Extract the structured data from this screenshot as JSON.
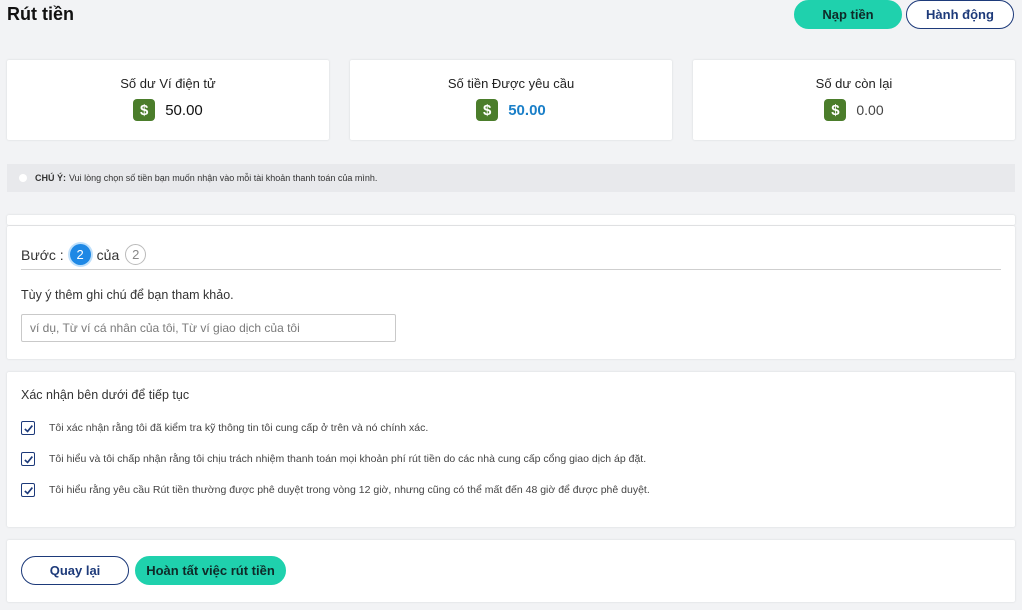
{
  "page": {
    "title": "Rút tiền"
  },
  "header": {
    "deposit_label": "Nạp tiền",
    "actions_label": "Hành động"
  },
  "stats": [
    {
      "title": "Số dư Ví điện tử",
      "value": "50.00"
    },
    {
      "title": "Số tiền Được yêu cầu",
      "value": "50.00"
    },
    {
      "title": "Số dư còn lại",
      "value": "0.00"
    }
  ],
  "currency_icon": "$",
  "notice": {
    "label": "CHÚ Ý:",
    "text": "Vui lòng chọn số tiền bạn muốn nhận vào mỗi tài khoản thanh toán của mình."
  },
  "step": {
    "prefix": "Bước :",
    "current": "2",
    "of_label": "của",
    "total": "2"
  },
  "note": {
    "label": "Tùy ý thêm ghi chú để bạn tham khảo.",
    "placeholder": "ví dụ, Từ ví cá nhân của tôi, Từ ví giao dịch của tôi",
    "value": ""
  },
  "confirm": {
    "title": "Xác nhận bên dưới để tiếp tục",
    "items": [
      {
        "label": "Tôi xác nhận rằng tôi đã kiểm tra kỹ thông tin tôi cung cấp ở trên và nó chính xác.",
        "checked": true
      },
      {
        "label": "Tôi hiểu và tôi chấp nhận rằng tôi chịu trách nhiệm thanh toán mọi khoản phí rút tiền do các nhà cung cấp cổng giao dịch áp đặt.",
        "checked": true
      },
      {
        "label": "Tôi hiểu rằng yêu cầu Rút tiền thường được phê duyệt trong vòng 12 giờ, nhưng cũng có thể mất đến 48 giờ để được phê duyệt.",
        "checked": true
      }
    ]
  },
  "footer": {
    "back_label": "Quay lại",
    "finish_label": "Hoàn tất việc rút tiền"
  },
  "colors": {
    "accent": "#1fd1ad",
    "navy": "#1d3a7a",
    "money_green": "#4b7d2b",
    "value_blue": "#1a7fc8",
    "step_blue": "#1e88e5"
  }
}
